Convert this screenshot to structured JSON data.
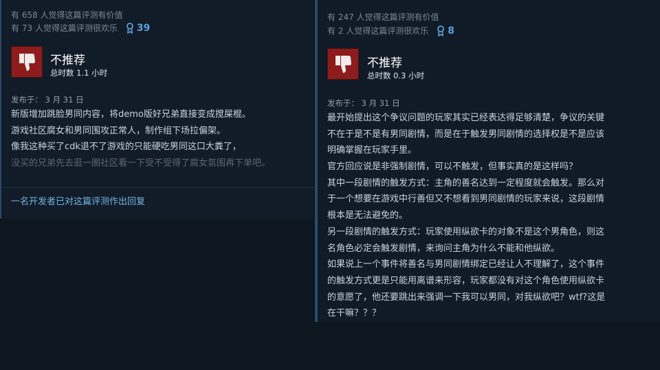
{
  "left_review": {
    "helpful_text": "有 658 人觉得这篇评测有价值",
    "funny_text": "有 73 人觉得这篇评测很欢乐",
    "award_count": "39",
    "verdict": "不推荐",
    "hours": "总时数 1.1 小时",
    "posted": "发布于： 3 月 31 日",
    "body": [
      "新版增加跳脸男同内容，将demo版好兄弟直接变成搅屎棍。",
      "游戏社区腐女和男同围攻正常人，制作组下场拉偏架。",
      "像我这种买了cdk退不了游戏的只能硬吃男同这口大粪了，",
      "没买的兄弟先去逛一圈社区看一下受不受得了腐女氛围再下单吧。"
    ],
    "dev_reply": "一名开发者已对这篇评测作出回复"
  },
  "right_review": {
    "helpful_text": "有 247 人觉得这篇评测有价值",
    "funny_text": "有 2 人觉得这篇评测很欢乐",
    "award_count": "8",
    "verdict": "不推荐",
    "hours": "总时数 0.3 小时",
    "posted": "发布于： 3 月 31 日",
    "body": [
      "最开始提出这个争议问题的玩家其实已经表达得足够清楚，争议的关键",
      "不在于是不是有男同剧情，而是在于触发男同剧情的选择权是不是应该",
      "明确掌握在玩家手里。",
      "官方回应说是非强制剧情，可以不触发，但事实真的是这样吗？",
      "其中一段剧情的触发方式：主角的善名达到一定程度就会触发。那么对",
      "于一个想要在游戏中行善但又不想看到男同剧情的玩家来说，这段剧情",
      "根本是无法避免的。",
      "另一段剧情的触发方式：玩家使用纵欲卡的对象不是这个男角色，则这",
      "名角色必定会触发剧情，来询问主角为什么不能和他纵欲。",
      "如果说上一个事件将善名与男同剧情绑定已经让人不理解了，这个事件",
      "的触发方式更是只能用离谱来形容，玩家都没有对这个角色使用纵欲卡",
      "的意愿了，他还要跳出来强调一下我可以男同，对我纵欲吧？wtf?这是",
      "在干嘛？？？"
    ]
  },
  "colors": {
    "background": "#0e1620",
    "card": "#111c28",
    "thumb_bg": "#8e1c1c",
    "award": "#5c9fd6",
    "link": "#73b6e6"
  },
  "icons": [
    "thumbs-down-icon",
    "award-icon"
  ]
}
